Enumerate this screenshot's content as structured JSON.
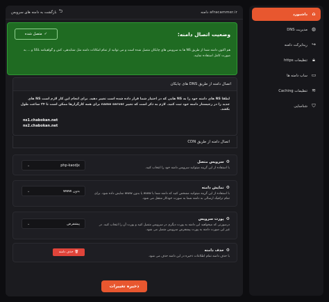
{
  "sidebar": {
    "items": [
      {
        "label": "داشبورد",
        "icon": "home-icon",
        "active": true
      },
      {
        "label": "مدیریت DNS",
        "icon": "globe-icon",
        "active": false
      },
      {
        "label": "ریدایرکت دامنه",
        "icon": "redirect-icon",
        "active": false
      },
      {
        "label": "تنظیمات https",
        "icon": "lock-icon",
        "active": false
      },
      {
        "label": "ساب دامنه ها",
        "icon": "folder-icon",
        "active": false
      },
      {
        "label": "تنظیمات Caching",
        "icon": "database-icon",
        "active": false
      },
      {
        "label": "شناسایی",
        "icon": "shield-icon",
        "active": false
      }
    ]
  },
  "topbar": {
    "domain": "afracammer.ir دامنه",
    "back_label": "بازگشت به دامنه های سرویس"
  },
  "status": {
    "title": "وضعیت اتصال دامنه:",
    "badge": "متصل شده",
    "description": "هم اکنون دامنه شما از طریق NS ها به سرویس های چابکان متصل شده است و می توانید از تمام امکانات دامنه مثل شتابدهی، کش و گواهینامه SSL و ... به صورت کامل استفاده نمایید."
  },
  "dns_section": {
    "title": "اتصال دامنه از طریق DNS های چابکان",
    "body": "لطفا NS های دامنه خود را به NS هایی که در اختیار شما قرار داده شده است تغییر دهید. برای انجام این کار لازم است NS های جدید را در رجیستار دامنه خود ثبت کنید. لازم به ذکر است که تغییر name server برای همه کارگزارها ممکن است تا ۲۴ ساعت طول بکشد.",
    "ns": [
      "ns1.chabokan.net",
      "ns2.chabokan.net"
    ]
  },
  "cdn_section": {
    "title": "اتصال دامنه از طریق CDN"
  },
  "settings": [
    {
      "key": "service",
      "title": "سرویس متصل",
      "icon": "gear-icon",
      "desc": "با استفاده از این گزینه میتوانید سرویس دامنه خود را انتخاب کنید.",
      "value": "php-kaodjx"
    },
    {
      "key": "display",
      "title": "نمایش دامنه",
      "icon": "gear-icon",
      "desc": "با استفاده از این گزینه میتوانید مشخص کنید که دامنه شما با www یا بدون www نمایش داده شود. برای تمام ترافیک ارسالی به دامنه شما به صورت خودکار منتقل می شود.",
      "value": "بدون www"
    },
    {
      "key": "port",
      "title": "پورت سرویس",
      "icon": "gear-icon",
      "desc": "درصورتی که میخواهید این دامنه به پورت دیگری در سرویس متصل کنید و پورت آن را انتخاب کنید. در غیر این صورت دامنه به پورت پیشفرض سرویس متصل می شود.",
      "value": "پیشفرض"
    },
    {
      "key": "delete",
      "title": "حذف دامنه",
      "icon": "trash-icon",
      "desc": "با حذف دامنه تمام اطلاعات ذخیره در این دامنه حذف می شود.",
      "button": "حذف دامنه"
    }
  ],
  "actions": {
    "save": "ذخیره تغییرات"
  },
  "colors": {
    "accent": "#e8572f",
    "success_bg": "#1f6b22",
    "danger": "#e0443a"
  }
}
